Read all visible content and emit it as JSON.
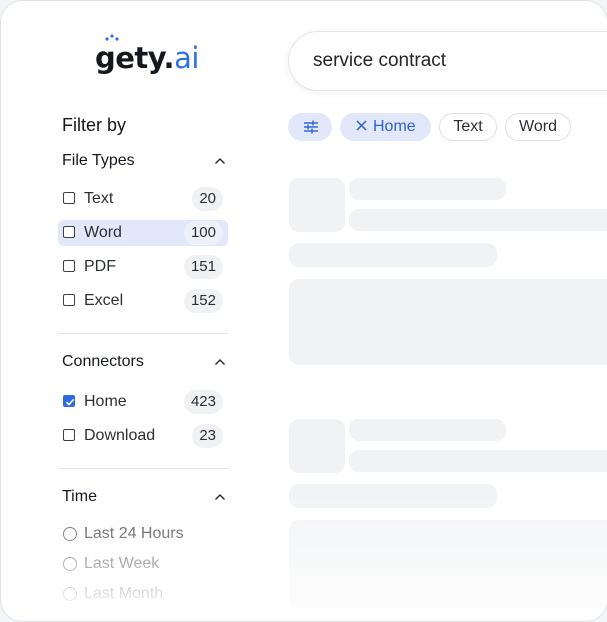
{
  "brand": {
    "logo_main": "gety",
    "logo_dot": ".",
    "logo_ai": "ai"
  },
  "search": {
    "value": "service contract"
  },
  "filter": {
    "title": "Filter by",
    "file_types": {
      "title": "File Types",
      "items": [
        {
          "label": "Text",
          "count": "20",
          "checked": false,
          "highlighted": false
        },
        {
          "label": "Word",
          "count": "100",
          "checked": false,
          "highlighted": true
        },
        {
          "label": "PDF",
          "count": "151",
          "checked": false,
          "highlighted": false
        },
        {
          "label": "Excel",
          "count": "152",
          "checked": false,
          "highlighted": false
        }
      ]
    },
    "connectors": {
      "title": "Connectors",
      "items": [
        {
          "label": "Home",
          "count": "423",
          "checked": true
        },
        {
          "label": "Download",
          "count": "23",
          "checked": false
        }
      ]
    },
    "time": {
      "title": "Time",
      "items": [
        {
          "label": "Last 24 Hours"
        },
        {
          "label": "Last Week"
        },
        {
          "label": "Last Month"
        }
      ]
    }
  },
  "chips": [
    {
      "icon": "sliders-icon"
    },
    {
      "label": "Home",
      "icon": "close-icon",
      "active": true
    },
    {
      "label": "Text",
      "active": false
    },
    {
      "label": "Word",
      "active": false
    }
  ],
  "icons": {
    "section_toggle": "chevron-up-icon",
    "checkbox_checked": "check-icon"
  },
  "colors": {
    "accent": "#2d6ae3",
    "highlight": "#e2e8f9",
    "skeleton": "#f1f2f4"
  }
}
